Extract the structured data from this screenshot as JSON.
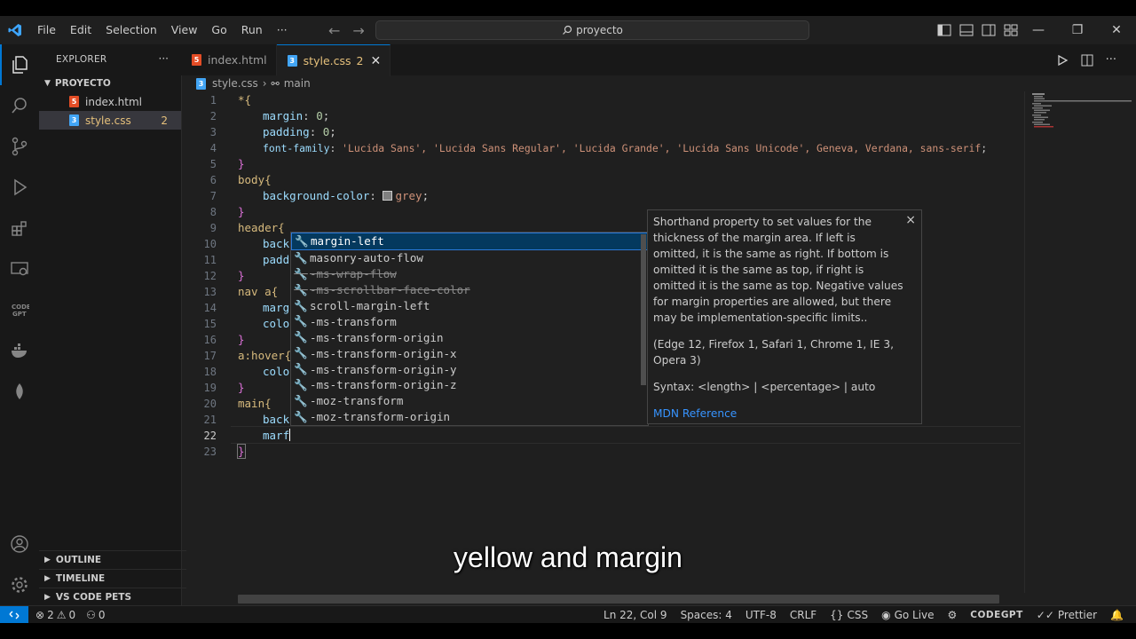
{
  "titlebar": {
    "menu": [
      "File",
      "Edit",
      "Selection",
      "View",
      "Go",
      "Run"
    ],
    "more": "···",
    "search": "proyecto"
  },
  "explorer": {
    "title": "EXPLORER",
    "more": "···",
    "folder": "PROYECTO",
    "files": [
      {
        "name": "index.html",
        "type": "html",
        "badge": ""
      },
      {
        "name": "style.css",
        "type": "css",
        "badge": "2"
      }
    ],
    "sections": [
      "OUTLINE",
      "TIMELINE",
      "VS CODE PETS"
    ]
  },
  "tabs": [
    {
      "label": "index.html",
      "num": "",
      "active": false
    },
    {
      "label": "style.css",
      "num": "2",
      "active": true
    }
  ],
  "breadcrumb": {
    "file": "style.css",
    "symbol": "main"
  },
  "editor": {
    "line_numbers": [
      "1",
      "2",
      "3",
      "4",
      "5",
      "6",
      "7",
      "8",
      "9",
      "10",
      "11",
      "12",
      "13",
      "14",
      "15",
      "16",
      "17",
      "18",
      "19",
      "20",
      "21",
      "22",
      "23"
    ],
    "lines": {
      "l1_sel": "*{",
      "l2_prop": "margin",
      "l2_val": "0",
      "l3_prop": "padding",
      "l3_val": "0",
      "l4_prop": "font-family",
      "l4_val": "'Lucida Sans', 'Lucida Sans Regular', 'Lucida Grande', 'Lucida Sans Unicode', Geneva, Verdana, sans-serif",
      "l5": "}",
      "l6_sel": "body{",
      "l7_prop": "background-color",
      "l7_val": "grey",
      "l8": "}",
      "l9_sel": "header{",
      "l10_prop": "back",
      "l11_prop": "padd",
      "l12": "}",
      "l13_sel": "nav a{",
      "l14_prop": "marg",
      "l15_prop": "colo",
      "l16": "}",
      "l17_sel": "a:hover{",
      "l18_prop": "colo",
      "l19": "}",
      "l20_sel": "main{",
      "l21_prop": "back",
      "l22_prop": "marf",
      "l23": "}"
    }
  },
  "suggestions": [
    {
      "label": "margin-left",
      "selected": true,
      "deprecated": false
    },
    {
      "label": "masonry-auto-flow",
      "selected": false,
      "deprecated": false
    },
    {
      "label": "-ms-wrap-flow",
      "selected": false,
      "deprecated": true
    },
    {
      "label": "-ms-scrollbar-face-color",
      "selected": false,
      "deprecated": true
    },
    {
      "label": "scroll-margin-left",
      "selected": false,
      "deprecated": false
    },
    {
      "label": "-ms-transform",
      "selected": false,
      "deprecated": false
    },
    {
      "label": "-ms-transform-origin",
      "selected": false,
      "deprecated": false
    },
    {
      "label": "-ms-transform-origin-x",
      "selected": false,
      "deprecated": false
    },
    {
      "label": "-ms-transform-origin-y",
      "selected": false,
      "deprecated": false
    },
    {
      "label": "-ms-transform-origin-z",
      "selected": false,
      "deprecated": false
    },
    {
      "label": "-moz-transform",
      "selected": false,
      "deprecated": false
    },
    {
      "label": "-moz-transform-origin",
      "selected": false,
      "deprecated": false
    }
  ],
  "docs": {
    "description": "Shorthand property to set values for the thickness of the margin area. If left is omitted, it is the same as right. If bottom is omitted it is the same as top, if right is omitted it is the same as top. Negative values for margin properties are allowed, but there may be implementation-specific limits..",
    "compat": "(Edge 12, Firefox 1, Safari 1, Chrome 1, IE 3, Opera 3)",
    "syntax": "Syntax: <length> | <percentage> | auto",
    "link": "MDN Reference",
    "close": "×"
  },
  "caption": "yellow and margin",
  "statusbar": {
    "errors": "2",
    "warnings": "0",
    "ports": "0",
    "position": "Ln 22, Col 9",
    "spaces": "Spaces: 4",
    "encoding": "UTF-8",
    "eol": "CRLF",
    "language": "CSS",
    "golive": "Go Live",
    "codegpt": "CODEGPT",
    "prettier": "Prettier"
  },
  "colors": {
    "accent": "#0078d4",
    "warning": "#e5c07b",
    "selection": "#04395e"
  }
}
